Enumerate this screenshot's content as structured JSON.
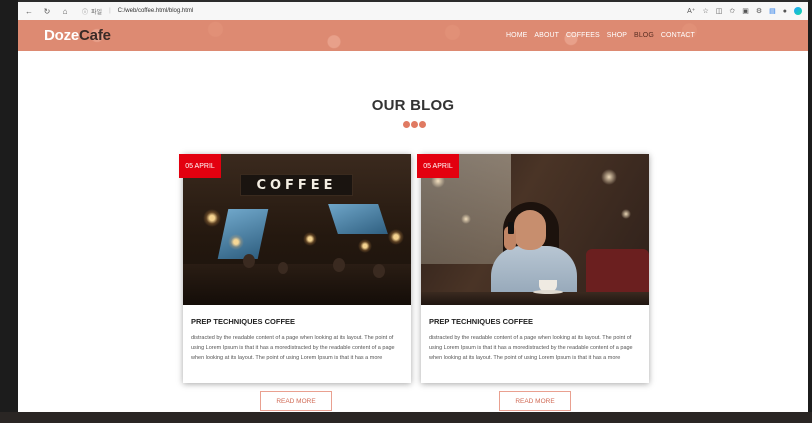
{
  "browser": {
    "info_label": "파일",
    "url": "C:/web/coffee.html/blog.html"
  },
  "site": {
    "logo_part1": "Doze",
    "logo_part2": "Cafe",
    "nav": [
      {
        "label": "HOME"
      },
      {
        "label": "ABOUT"
      },
      {
        "label": "COFFEES"
      },
      {
        "label": "SHOP"
      },
      {
        "label": "BLOG"
      },
      {
        "label": "CONTACT"
      }
    ],
    "active_nav": "BLOG",
    "accent_color": "#dd8a72",
    "badge_color": "#e3000f"
  },
  "blog": {
    "title": "OUR BLOG",
    "posts": [
      {
        "date": "05 APRIL",
        "sign_text": "COFFEE",
        "title": "PREP TECHNIQUES COFFEE",
        "text": "distracted by the readable content of a page when looking at its layout. The point of using Lorem Ipsum is that it has a moredistracted by the readable content of a page when looking at its layout. The point of using Lorem Ipsum is that it has a more",
        "button": "READ MORE"
      },
      {
        "date": "05 APRIL",
        "title": "PREP TECHNIQUES COFFEE",
        "text": "distracted by the readable content of a page when looking at its layout. The point of using Lorem Ipsum is that it has a moredistracted by the readable content of a page when looking at its layout. The point of using Lorem Ipsum is that it has a more",
        "button": "READ MORE"
      }
    ]
  }
}
